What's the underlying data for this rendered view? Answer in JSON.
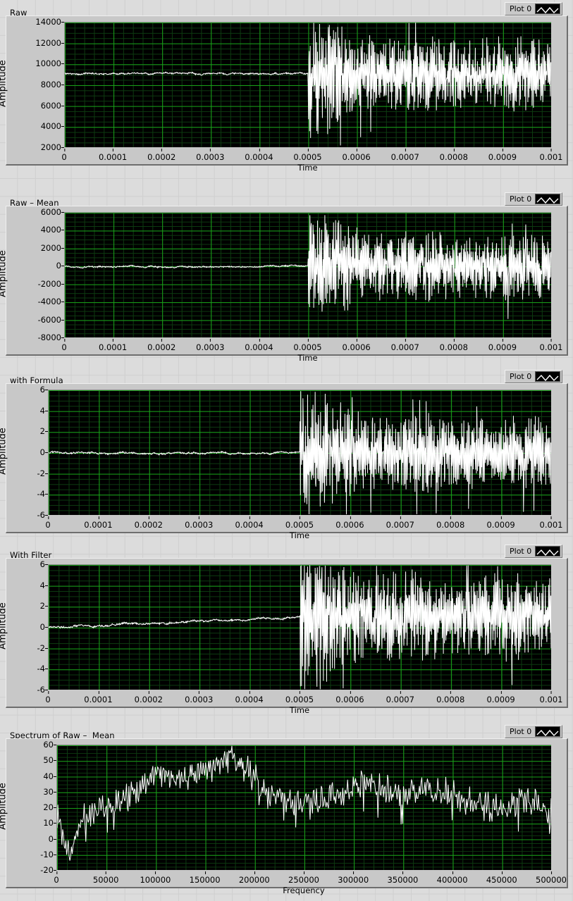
{
  "graphs": [
    {
      "title": "Raw",
      "legend": {
        "label": "Plot 0",
        "icon": "waveform-icon"
      },
      "chart_data": {
        "type": "line",
        "title": "Raw",
        "xlabel": "Time",
        "ylabel": "Amplitude",
        "xlim": [
          0,
          0.001
        ],
        "ylim": [
          2000,
          14000
        ],
        "xticks": [
          "0",
          "0.0001",
          "0.0002",
          "0.0003",
          "0.0004",
          "0.0005",
          "0.0006",
          "0.0007",
          "0.0008",
          "0.0009",
          "0.001"
        ],
        "yticks": [
          "14000",
          "12000",
          "10000",
          "8000",
          "6000",
          "4000",
          "2000"
        ],
        "grid": true,
        "legend_position": "top-right",
        "series": [
          {
            "name": "Plot 0",
            "color": "#ffffff",
            "description": "Flat baseline near 9000 until t=0.0005, then high-amplitude noise burst oscillating roughly between 5500 and 12800, slowly decaying toward 6500-11500.",
            "baseline": 9100,
            "burst_start_x": 0.0005,
            "burst_min": 3000,
            "burst_max": 13100
          }
        ]
      }
    },
    {
      "title": "Raw – Mean",
      "legend": {
        "label": "Plot 0",
        "icon": "waveform-icon"
      },
      "chart_data": {
        "type": "line",
        "title": "Raw – Mean",
        "xlabel": "Time",
        "ylabel": "Amplitude",
        "xlim": [
          0,
          0.001
        ],
        "ylim": [
          -8000,
          6000
        ],
        "xticks": [
          "0",
          "0.0001",
          "0.0002",
          "0.0003",
          "0.0004",
          "0.0005",
          "0.0006",
          "0.0007",
          "0.0008",
          "0.0009",
          "0.001"
        ],
        "yticks": [
          "6000",
          "4000",
          "2000",
          "0",
          "-2000",
          "-4000",
          "-6000",
          "-8000"
        ],
        "grid": true,
        "legend_position": "top-right",
        "series": [
          {
            "name": "Plot 0",
            "color": "#ffffff",
            "description": "Flat at 0 until t=0.0005, then mean-removed noise burst oscillating between about -3000 and +3000 with peaks to -6000 and +4800.",
            "baseline": 0,
            "burst_start_x": 0.0005,
            "burst_min": -6000,
            "burst_max": 4800
          }
        ]
      }
    },
    {
      "title": "with Formula",
      "legend": {
        "label": "Plot 0",
        "icon": "waveform-icon"
      },
      "chart_data": {
        "type": "line",
        "title": "with Formula",
        "xlabel": "Time",
        "ylabel": "Amplitude",
        "xlim": [
          0,
          0.001
        ],
        "ylim": [
          -6,
          6
        ],
        "xticks": [
          "0",
          "0.0001",
          "0.0002",
          "0.0003",
          "0.0004",
          "0.0005",
          "0.0006",
          "0.0007",
          "0.0008",
          "0.0009",
          "0.001"
        ],
        "yticks": [
          "6",
          "4",
          "2",
          "0",
          "-2",
          "-4",
          "-6"
        ],
        "grid": true,
        "legend_position": "top-right",
        "series": [
          {
            "name": "Plot 0",
            "color": "#ffffff",
            "description": "Flat at 0 until t=0.0005, then scaled noise burst oscillating between about -3 and +3 with peaks to -6 and +4.6.",
            "baseline": 0,
            "burst_start_x": 0.0005,
            "burst_min": -6,
            "burst_max": 4.6
          }
        ]
      }
    },
    {
      "title": "With Filter",
      "legend": {
        "label": "Plot 0",
        "icon": "waveform-icon"
      },
      "chart_data": {
        "type": "line",
        "title": "With Filter",
        "xlabel": "Time",
        "ylabel": "Amplitude",
        "xlim": [
          0,
          0.001
        ],
        "ylim": [
          -6,
          6
        ],
        "xticks": [
          "0",
          "0.0001",
          "0.0002",
          "0.0003",
          "0.0004",
          "0.0005",
          "0.0006",
          "0.0007",
          "0.0008",
          "0.0009",
          "0.001"
        ],
        "yticks": [
          "6",
          "4",
          "2",
          "0",
          "-2",
          "-4",
          "-6"
        ],
        "grid": true,
        "legend_position": "top-right",
        "series": [
          {
            "name": "Plot 0",
            "color": "#ffffff",
            "description": "Filtered signal: baseline drifts slowly upward from 0 to about 1 between t=0 and t=0.0005, then a noise burst oscillating between about -3 and +3.5 with peaks to -6 and +6.",
            "baseline_start": 0,
            "baseline_end": 1.0,
            "burst_start_x": 0.0005,
            "burst_min": -6,
            "burst_max": 6
          }
        ]
      }
    },
    {
      "title": "Spectrum of Raw –  Mean",
      "legend": {
        "label": "Plot 0",
        "icon": "waveform-icon"
      },
      "chart_data": {
        "type": "line",
        "title": "Spectrum of Raw –  Mean",
        "xlabel": "Frequency",
        "ylabel": "Amplitude",
        "xlim": [
          0,
          500000
        ],
        "ylim": [
          -20,
          60
        ],
        "xticks": [
          "0",
          "50000",
          "100000",
          "150000",
          "200000",
          "250000",
          "300000",
          "350000",
          "400000",
          "450000",
          "500000"
        ],
        "yticks": [
          "60",
          "50",
          "40",
          "30",
          "20",
          "10",
          "0",
          "-10",
          "-20"
        ],
        "grid": true,
        "legend_position": "top-right",
        "series": [
          {
            "name": "Plot 0",
            "color": "#ffffff",
            "description": "Spectrum rising from about 13 dB at DC, dipping to -11 near 12 kHz, climbing through 20-35 dB between 30k-90k, broad peaks of 45-53 dB between 100k and 195k, dropping to 20-30 dB around 210k-260k, rising again to 35-40 dB near 300k-320k, then fluctuating 15-35 dB out to 500k.",
            "x": [
              0,
              12000,
              25000,
              40000,
              60000,
              80000,
              100000,
              120000,
              140000,
              160000,
              175000,
              190000,
              210000,
              230000,
              250000,
              270000,
              290000,
              310000,
              330000,
              350000,
              370000,
              390000,
              410000,
              430000,
              450000,
              470000,
              490000,
              500000
            ],
            "y": [
              13,
              -11,
              10,
              18,
              22,
              30,
              45,
              38,
              42,
              46,
              53,
              47,
              30,
              26,
              22,
              25,
              30,
              37,
              30,
              28,
              32,
              30,
              24,
              22,
              18,
              26,
              20,
              16
            ]
          }
        ]
      }
    }
  ]
}
